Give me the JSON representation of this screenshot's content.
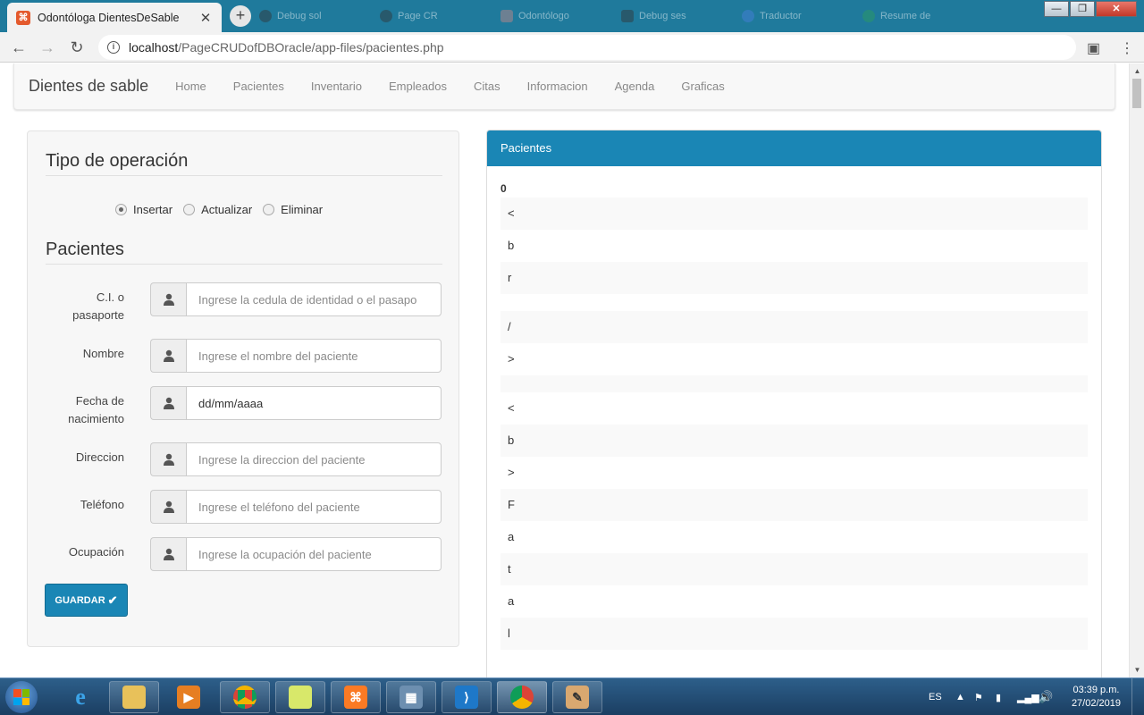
{
  "browser": {
    "active_tab_title": "Odontóloga DientesDeSable",
    "background_tabs": [
      "Debug sol",
      "Page CR",
      "Odontólogo",
      "Debug ses",
      "Traductor",
      "Resume de"
    ],
    "url_host": "localhost",
    "url_path": "/PageCRUDofDBOracle/app-files/pacientes.php",
    "window_controls": {
      "minimize": "—",
      "restore": "❐",
      "close": "✕"
    }
  },
  "navbar": {
    "brand": "Dientes de sable",
    "links": [
      "Home",
      "Pacientes",
      "Inventario",
      "Empleados",
      "Citas",
      "Informacion",
      "Agenda",
      "Graficas"
    ]
  },
  "form": {
    "operation_title": "Tipo de operación",
    "operations": [
      {
        "label": "Insertar",
        "checked": true
      },
      {
        "label": "Actualizar",
        "checked": false
      },
      {
        "label": "Eliminar",
        "checked": false
      }
    ],
    "section_title": "Pacientes",
    "fields": [
      {
        "label_line1": "C.I. o",
        "label_line2": "pasaporte",
        "placeholder": "Ingrese la cedula de identidad o el pasapo",
        "icon": "user-icon"
      },
      {
        "label_line1": "Nombre",
        "label_line2": "",
        "placeholder": "Ingrese el nombre del paciente",
        "icon": "user-icon"
      },
      {
        "label_line1": "Fecha de",
        "label_line2": "nacimiento",
        "value": "dd/mm/aaaa",
        "icon": "user-icon"
      },
      {
        "label_line1": "Direccion",
        "label_line2": "",
        "placeholder": "Ingrese la direccion del paciente",
        "icon": "user-icon"
      },
      {
        "label_line1": "Teléfono",
        "label_line2": "",
        "placeholder": "Ingrese el teléfono del paciente",
        "icon": "user-icon"
      },
      {
        "label_line1": "Ocupación",
        "label_line2": "",
        "placeholder": "Ingrese la ocupación del paciente",
        "icon": "user-icon"
      }
    ],
    "save_label": "GUARDAR"
  },
  "results": {
    "heading": "Pacientes",
    "column_header": "0",
    "rows": [
      "<",
      "b",
      "r",
      "",
      "/",
      ">",
      "",
      "<",
      "b",
      ">",
      "F",
      "a",
      "t",
      "a",
      "l"
    ]
  },
  "taskbar": {
    "language": "ES",
    "time": "03:39 p.m.",
    "date": "27/02/2019"
  },
  "colors": {
    "primary": "#1a86b5",
    "tabbar": "#1f7a9c",
    "taskbar": "#1b3e62"
  }
}
